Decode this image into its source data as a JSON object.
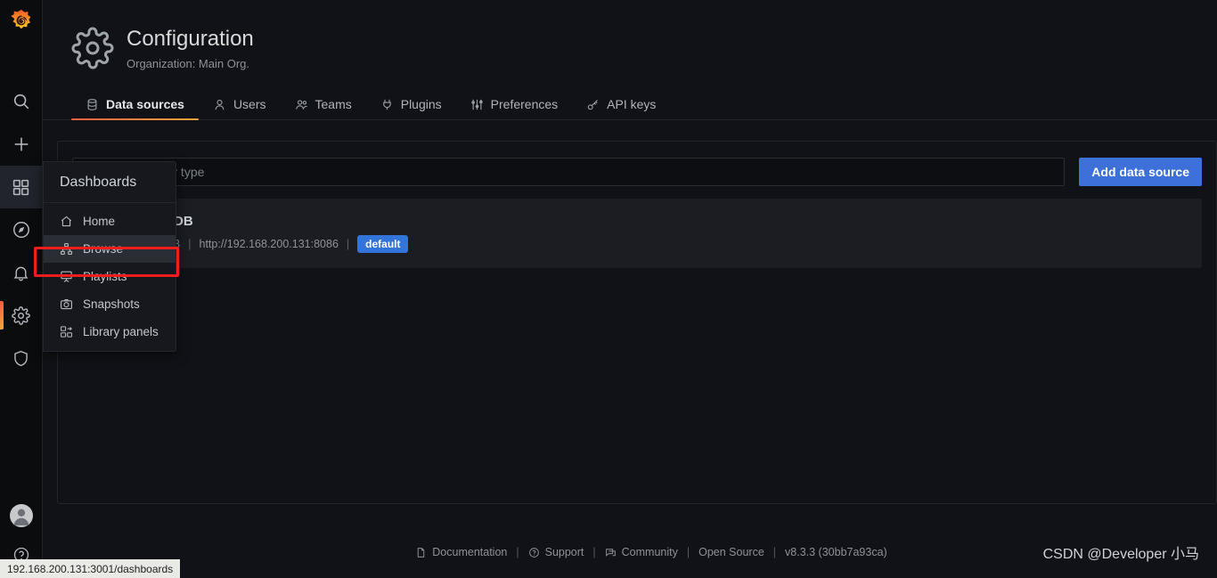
{
  "brand": {
    "logo_name": "grafana-logo",
    "accent": "#f55f3e",
    "primary_button": "#3d71d9"
  },
  "rail": {
    "items": [
      {
        "name": "search",
        "label": "Search"
      },
      {
        "name": "create",
        "label": "Create"
      },
      {
        "name": "dashboards",
        "label": "Dashboards"
      },
      {
        "name": "explore",
        "label": "Explore"
      },
      {
        "name": "alerting",
        "label": "Alerting"
      },
      {
        "name": "configuration",
        "label": "Configuration"
      },
      {
        "name": "server-admin",
        "label": "Server Admin"
      }
    ],
    "bottom": [
      {
        "name": "user-avatar",
        "label": "User"
      },
      {
        "name": "help",
        "label": "Help"
      }
    ]
  },
  "header": {
    "icon": "gear-icon",
    "title": "Configuration",
    "subtitle": "Organization: Main Org."
  },
  "tabs": [
    {
      "label": "Data sources",
      "icon": "database-icon",
      "active": true
    },
    {
      "label": "Users",
      "icon": "user-icon",
      "active": false
    },
    {
      "label": "Teams",
      "icon": "users-icon",
      "active": false
    },
    {
      "label": "Plugins",
      "icon": "plug-icon",
      "active": false
    },
    {
      "label": "Preferences",
      "icon": "sliders-icon",
      "active": false
    },
    {
      "label": "API keys",
      "icon": "key-icon",
      "active": false
    }
  ],
  "toolbar": {
    "search_placeholder": "Filter by name or type",
    "search_value": "",
    "add_button_label": "Add data source"
  },
  "datasources": [
    {
      "name": "InfluxDB",
      "type": "InfluxDB",
      "url": "http://192.168.200.131:8086",
      "badge": "default",
      "logo": "influxdb-logo"
    }
  ],
  "flyout": {
    "title": "Dashboards",
    "items": [
      {
        "label": "Home",
        "icon": "home-icon",
        "highlighted": false
      },
      {
        "label": "Browse",
        "icon": "sitemap-icon",
        "highlighted": true
      },
      {
        "label": "Playlists",
        "icon": "presentation-icon",
        "highlighted": false
      },
      {
        "label": "Snapshots",
        "icon": "camera-icon",
        "highlighted": false
      },
      {
        "label": "Library panels",
        "icon": "library-panels-icon",
        "highlighted": false
      }
    ]
  },
  "footer": {
    "links": [
      {
        "label": "Documentation",
        "icon": "document-icon"
      },
      {
        "label": "Support",
        "icon": "question-circle-icon"
      },
      {
        "label": "Community",
        "icon": "comments-icon"
      },
      {
        "label": "Open Source",
        "icon": ""
      }
    ],
    "version": "v8.3.3 (30bb7a93ca)",
    "separator": "|"
  },
  "status_bar": {
    "url": "192.168.200.131:3001/dashboards"
  },
  "watermark": {
    "text": "CSDN @Developer 小马"
  }
}
